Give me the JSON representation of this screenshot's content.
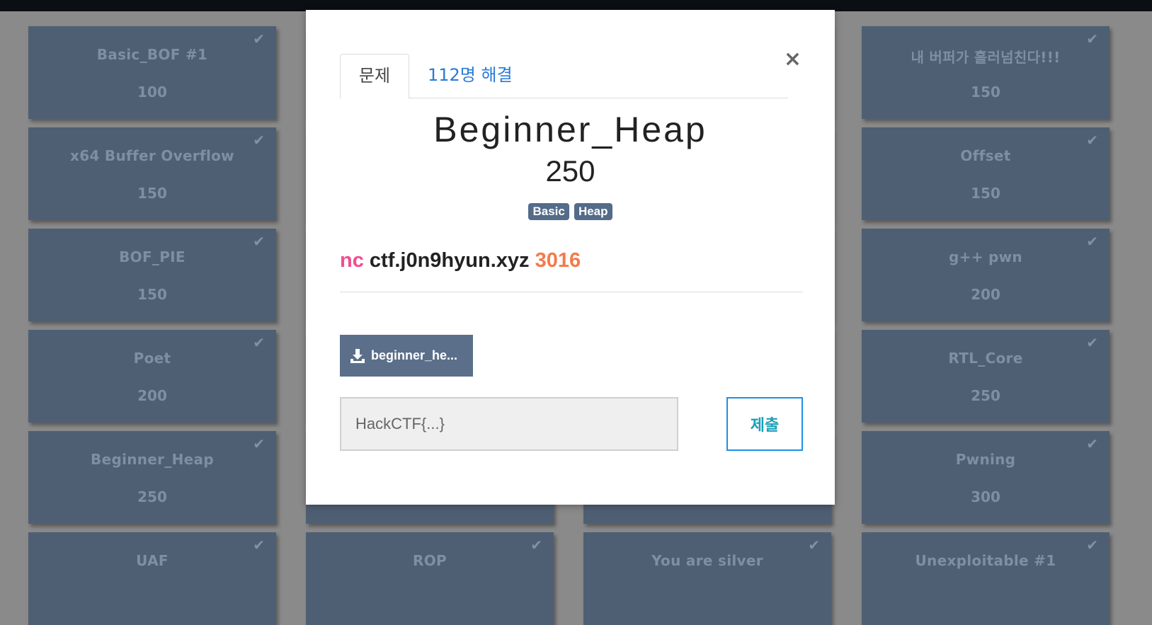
{
  "challenges": {
    "col1": [
      {
        "name": "Basic_BOF #1",
        "points": "100"
      },
      {
        "name": "x64 Buffer Overflow",
        "points": "150"
      },
      {
        "name": "BOF_PIE",
        "points": "150"
      },
      {
        "name": "Poet",
        "points": "200"
      },
      {
        "name": "Beginner_Heap",
        "points": "250"
      },
      {
        "name": "UAF",
        "points": ""
      }
    ],
    "col2": [
      {
        "name": "ROP",
        "points": ""
      }
    ],
    "col3": [
      {
        "name": "You are silver",
        "points": ""
      }
    ],
    "col4": [
      {
        "name": "내 버퍼가 흘러넘친다!!!",
        "points": "150"
      },
      {
        "name": "Offset",
        "points": "150"
      },
      {
        "name": "g++ pwn",
        "points": "200"
      },
      {
        "name": "RTL_Core",
        "points": "250"
      },
      {
        "name": "Pwning",
        "points": "300"
      },
      {
        "name": "Unexploitable #1",
        "points": ""
      }
    ],
    "check_icon": "check-icon"
  },
  "modal": {
    "tab_problem": "문제",
    "tab_solves": "112명 해결",
    "close": "×",
    "title": "Beginner_Heap",
    "points": "250",
    "tags": [
      "Basic",
      "Heap"
    ],
    "desc_nc": "nc",
    "desc_host": "ctf.j0n9hyun.xyz",
    "desc_port": "3016",
    "download_label": "beginner_he...",
    "flag_placeholder": "HackCTF{...}",
    "submit_label": "제출"
  },
  "colors": {
    "card": "#4f5f73",
    "tag": "#546b89",
    "nc": "#f04e8f",
    "port": "#f47a4a",
    "link": "#2a7ad6"
  }
}
